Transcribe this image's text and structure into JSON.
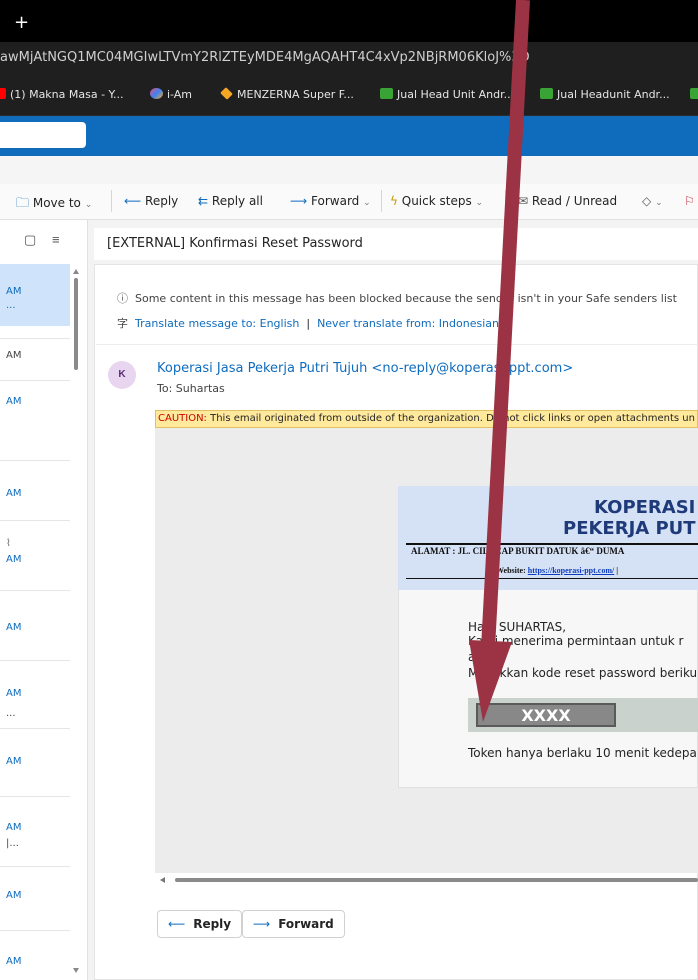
{
  "browser": {
    "new_tab_glyph": "+",
    "url": "awMjAtNGQ1MC04MGIwLTVmY2RlZTEyMDE4MgAQAHT4C4xVp2NBjRM06KloJ%3D",
    "bookmarks": [
      {
        "label": "(1) Makna Masa - Y...",
        "icon": "youtube-icon",
        "color": "#ff0000"
      },
      {
        "label": "i-Am",
        "icon": "colorful-logo-icon",
        "color": "#e94e77"
      },
      {
        "label": "MENZERNA Super F...",
        "icon": "diamond-icon",
        "color": "#f5a623"
      },
      {
        "label": "Jual Head Unit Andr...",
        "icon": "shop-icon",
        "color": "#3aa335"
      },
      {
        "label": "Jual Headunit Andr...",
        "icon": "shop-icon",
        "color": "#3aa335"
      }
    ]
  },
  "toolbar": {
    "move_to": "Move to",
    "reply": "Reply",
    "reply_all": "Reply all",
    "forward": "Forward",
    "quick_steps": "Quick steps",
    "read_unread": "Read / Unread"
  },
  "message_list": {
    "times": [
      "AM",
      "AM",
      "AM",
      "AM",
      "AM",
      "AM",
      "AM",
      "AM",
      "AM",
      "AM",
      "AM"
    ],
    "snippets": [
      "...",
      "...",
      "|..."
    ]
  },
  "email": {
    "subject": "[EXTERNAL] Konfirmasi Reset Password",
    "blocked_notice": "Some content in this message has been blocked because the sender isn't in your Safe senders list",
    "translate_link": "Translate message to: English",
    "translate_sep": "|",
    "never_translate_link": "Never translate from: Indonesian",
    "avatar_initial": "K",
    "sender": "Koperasi Jasa Pekerja Putri Tujuh <no-reply@koperasi-ppt.com>",
    "to_line": "To:  Suhartas",
    "caution_label": "CAUTION:",
    "caution_text": " This email originated from outside of the organization. Do not click links or open attachments un",
    "letter": {
      "title_line1": "KOPERASI",
      "title_line2": "PEKERJA PUT",
      "address": "ALAMAT : JL. CILACAP BUKIT DATUK â€“ DUMA",
      "website_label": "Website:",
      "website_url": "https://koperasi-ppt.com/",
      "website_tail": " | ",
      "greeting": "Halo SUHARTAS,",
      "line1": "Kami menerima permintaan untuk r",
      "line2": "a",
      "line3": "Masukkan kode reset password beriku",
      "code": "XXXX",
      "token_note": "Token hanya berlaku 10 menit kedepa"
    },
    "reply_button": "Reply",
    "forward_button": "Forward"
  },
  "annotation": {
    "arrow_color": "#9b3344"
  }
}
